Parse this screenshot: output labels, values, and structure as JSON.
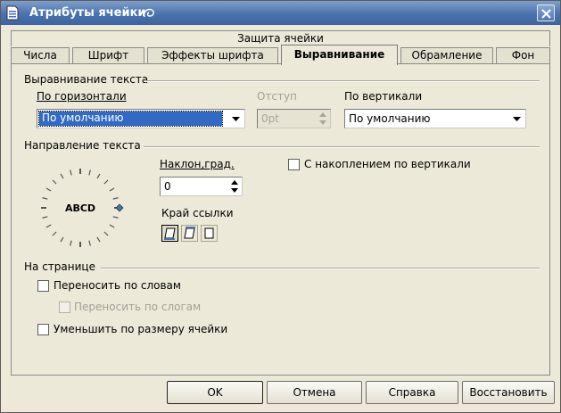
{
  "window": {
    "title": "Атрибуты ячейки"
  },
  "tabs": {
    "top_row": "Защита ячейки",
    "items": [
      {
        "label": "Числа"
      },
      {
        "label": "Шрифт"
      },
      {
        "label": "Эффекты шрифта"
      },
      {
        "label": "Выравнивание",
        "active": true
      },
      {
        "label": "Обрамление"
      },
      {
        "label": "Фон"
      }
    ]
  },
  "alignment": {
    "group_title": "Выравнивание текста",
    "horizontal_label": "По горизонтали",
    "horizontal_value": "По умолчанию",
    "indent_label": "Отступ",
    "indent_value": "0pt",
    "vertical_label": "По вертикали",
    "vertical_value": "По умолчанию"
  },
  "direction": {
    "group_title": "Направление текста",
    "dial_text": "ABCD",
    "angle_label": "Наклон,град.",
    "angle_value": "0",
    "stacked_label": "С накоплением по вертикали",
    "edge_label": "Край ссылки"
  },
  "page": {
    "group_title": "На странице",
    "wrap_words": "Переносить по словам",
    "hyphenation": "Переносить по слогам",
    "shrink": "Уменьшить по размеру ячейки"
  },
  "buttons": {
    "ok": "OK",
    "cancel": "Отмена",
    "help": "Справка",
    "reset": "Восстановить"
  },
  "colors": {
    "titlebar": "#4a72ad",
    "selection": "#316ac5",
    "dialog_bg": "#ece9d8"
  }
}
